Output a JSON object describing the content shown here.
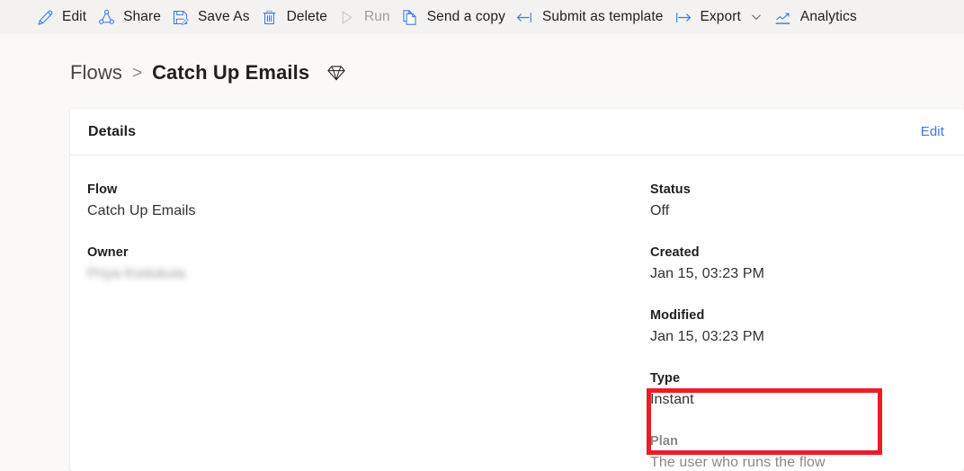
{
  "toolbar": {
    "items": [
      {
        "label": "Edit",
        "icon": "pencil-icon",
        "disabled": false,
        "chevron": false
      },
      {
        "label": "Share",
        "icon": "share-nodes-icon",
        "disabled": false,
        "chevron": false
      },
      {
        "label": "Save As",
        "icon": "save-as-icon",
        "disabled": false,
        "chevron": false
      },
      {
        "label": "Delete",
        "icon": "trash-icon",
        "disabled": false,
        "chevron": false
      },
      {
        "label": "Run",
        "icon": "play-icon",
        "disabled": true,
        "chevron": false
      },
      {
        "label": "Send a copy",
        "icon": "copy-page-icon",
        "disabled": false,
        "chevron": false
      },
      {
        "label": "Submit as template",
        "icon": "arrow-left-bar-icon",
        "disabled": false,
        "chevron": false
      },
      {
        "label": "Export",
        "icon": "arrow-right-bar-icon",
        "disabled": false,
        "chevron": true
      },
      {
        "label": "Analytics",
        "icon": "line-chart-icon",
        "disabled": false,
        "chevron": false
      }
    ]
  },
  "breadcrumb": {
    "root": "Flows",
    "separator": ">",
    "current": "Catch Up Emails",
    "badge_icon": "gem-icon"
  },
  "details_card": {
    "title": "Details",
    "edit_label": "Edit",
    "left_fields": [
      {
        "label": "Flow",
        "value": "Catch Up Emails",
        "blurred": false
      },
      {
        "label": "Owner",
        "value": "Priya Kodukula",
        "blurred": true
      }
    ],
    "right_fields": [
      {
        "label": "Status",
        "value": "Off"
      },
      {
        "label": "Created",
        "value": "Jan 15, 03:23 PM"
      },
      {
        "label": "Modified",
        "value": "Jan 15, 03:23 PM"
      },
      {
        "label": "Type",
        "value": "Instant"
      }
    ],
    "plan_field": {
      "label": "Plan",
      "value": "The user who runs the flow"
    }
  },
  "annotation": {
    "highlight_color": "#ec1c24",
    "target": "plan-field"
  },
  "colors": {
    "accent_link": "#3b78e7",
    "icon_blue": "#3b78e7",
    "toolbar_bg": "#f3f2f1",
    "page_bg": "#faf9f8",
    "card_bg": "#ffffff"
  }
}
